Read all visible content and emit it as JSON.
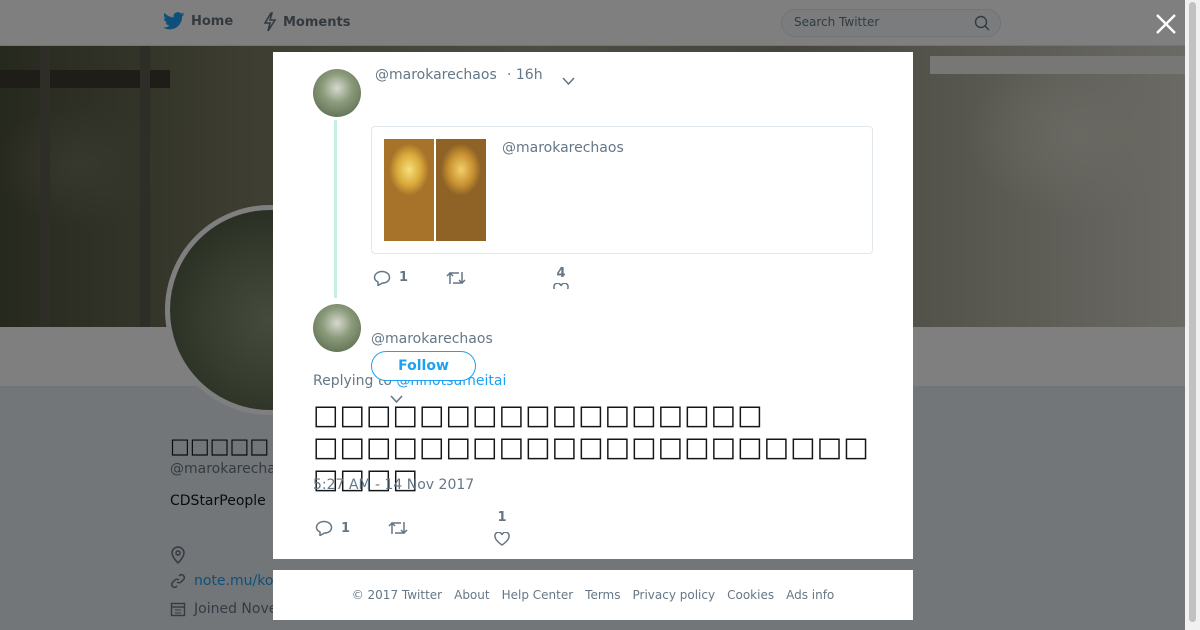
{
  "nav": {
    "home": "Home",
    "moments": "Moments"
  },
  "search": {
    "placeholder": "Search Twitter"
  },
  "profile": {
    "name": "□□□□□",
    "handle": "@marokarecha",
    "bio": "CDStarPeople",
    "url": "note.mu/ko",
    "joined": "Joined Nove"
  },
  "modal": {
    "tweet1": {
      "handle": "@marokarechaos",
      "time": "· 16h",
      "quote_handle": "@marokarechaos",
      "replies": "1",
      "likes": "4"
    },
    "tweet2": {
      "handle": "@marokarechaos",
      "follow": "Follow",
      "replying_label": "Replying to",
      "replying_to": "@hinotsumeitai",
      "text": "□□□□□□□□□□□□□□□□□\n□□□□□□□□□□□□□□□□□□□□□□□□□",
      "date": "5:27 AM - 14 Nov 2017",
      "replies": "1",
      "likes": "1"
    }
  },
  "footer": {
    "links": [
      "© 2017 Twitter",
      "About",
      "Help Center",
      "Terms",
      "Privacy policy",
      "Cookies",
      "Ads info"
    ]
  },
  "colors": {
    "accent": "#1da1f2",
    "thread": "#c4efe1",
    "muted": "#657786"
  }
}
